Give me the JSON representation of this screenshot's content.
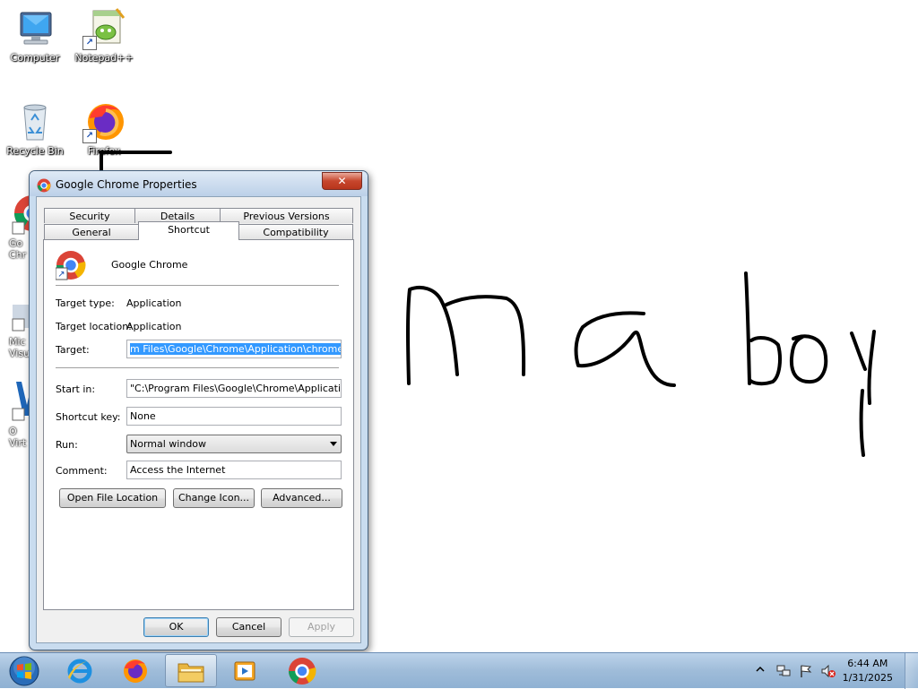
{
  "desktop": {
    "icons": [
      {
        "label": "Computer",
        "icon": "computer-icon"
      },
      {
        "label": "Notepad++",
        "icon": "notepadpp-icon"
      },
      {
        "label": "Recycle Bin",
        "icon": "recycle-bin-icon"
      },
      {
        "label": "Firefox",
        "icon": "firefox-icon"
      }
    ],
    "partial_icons": [
      {
        "label": "Go\nChr",
        "icon": "chrome-icon"
      },
      {
        "label": "Mic\nVisua",
        "icon": "visual-studio-icon"
      },
      {
        "label": "O\nVirt",
        "icon": "virtualbox-icon"
      }
    ]
  },
  "dialog": {
    "title": "Google Chrome Properties",
    "close_label": "✕",
    "tabs_row1": [
      "Security",
      "Details",
      "Previous Versions"
    ],
    "tabs_row2": [
      "General",
      "Shortcut",
      "Compatibility"
    ],
    "active_tab": "Shortcut",
    "app_name": "Google Chrome",
    "fields": {
      "target_type_label": "Target type:",
      "target_type_value": "Application",
      "target_location_label": "Target location:",
      "target_location_value": "Application",
      "target_label": "Target:",
      "target_value": "m Files\\Google\\Chrome\\Application\\chrome.exe\"",
      "start_in_label": "Start in:",
      "start_in_value": "\"C:\\Program Files\\Google\\Chrome\\Application\"",
      "shortcut_key_label": "Shortcut key:",
      "shortcut_key_value": "None",
      "run_label": "Run:",
      "run_value": "Normal window",
      "comment_label": "Comment:",
      "comment_value": "Access the Internet"
    },
    "buttons": {
      "open_file_location": "Open File Location",
      "change_icon": "Change Icon...",
      "advanced": "Advanced...",
      "ok": "OK",
      "cancel": "Cancel",
      "apply": "Apply"
    }
  },
  "taskbar": {
    "items": [
      "start-orb",
      "internet-explorer-icon",
      "firefox-icon",
      "file-explorer-icon",
      "media-player-icon",
      "chrome-icon"
    ],
    "clock_time": "6:44 AM",
    "clock_date": "1/31/2025"
  },
  "colors": {
    "selection": "#3399ff",
    "close_button": "#c7462d",
    "taskbar": "#9fbcd9"
  }
}
